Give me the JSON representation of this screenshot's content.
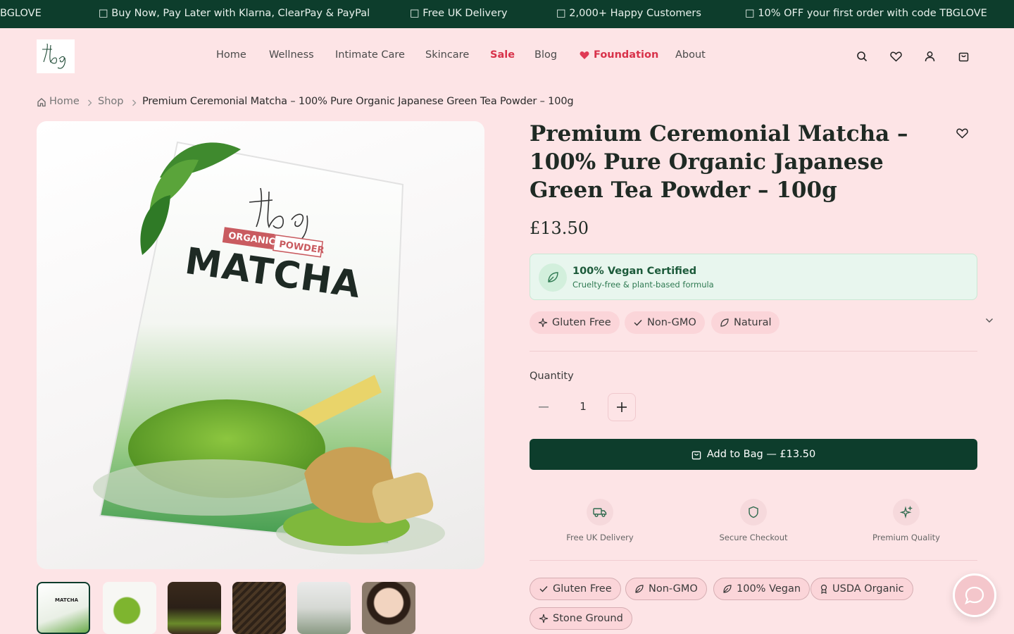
{
  "announcement": {
    "items": [
      "BGLOVE",
      "□ Buy Now, Pay Later with Klarna, ClearPay & PayPal",
      "□ Free UK Delivery",
      "□ 2,000+ Happy Customers",
      "□ 10% OFF your first order with code TBGLOVE"
    ]
  },
  "header": {
    "logo_text": "tbg",
    "nav": {
      "home": "Home",
      "wellness": "Wellness",
      "intimate_care": "Intimate Care",
      "skincare": "Skincare",
      "sale": "Sale",
      "blog": "Blog",
      "foundation": "Foundation",
      "about": "About"
    },
    "icons": [
      "search-icon",
      "heart-icon",
      "user-icon",
      "bag-icon"
    ]
  },
  "breadcrumb": {
    "home": "Home",
    "shop": "Shop",
    "current": "Premium Ceremonial Matcha – 100% Pure Organic Japanese Green Tea Powder – 100g"
  },
  "gallery": {
    "pack_brand": "tbg",
    "pack_tag1": "ORGANIC",
    "pack_tag2": "POWDER",
    "pack_title": "MATCHA",
    "thumb_text": "MATCHA"
  },
  "product": {
    "title": "Premium Ceremonial Matcha – 100% Pure Organic Japanese Green Tea Powder – 100g",
    "price": "£13.50",
    "vegan_card": {
      "title": "100% Vegan Certified",
      "subtitle": "Cruelty-free & plant-based formula"
    },
    "tags": [
      "Gluten Free",
      "Non-GMO",
      "Natural"
    ],
    "quantity_label": "Quantity",
    "quantity": "1",
    "add_to_bag": "Add to Bag — £13.50",
    "features": [
      "Free UK Delivery",
      "Secure Checkout",
      "Premium Quality"
    ],
    "badges": [
      "Gluten Free",
      "Non-GMO",
      "100% Vegan",
      "USDA Organic",
      "Stone Ground"
    ]
  },
  "colors": {
    "background": "#fde4e6",
    "primary_green": "#0d3d2c",
    "sale_red": "#d8324a"
  }
}
